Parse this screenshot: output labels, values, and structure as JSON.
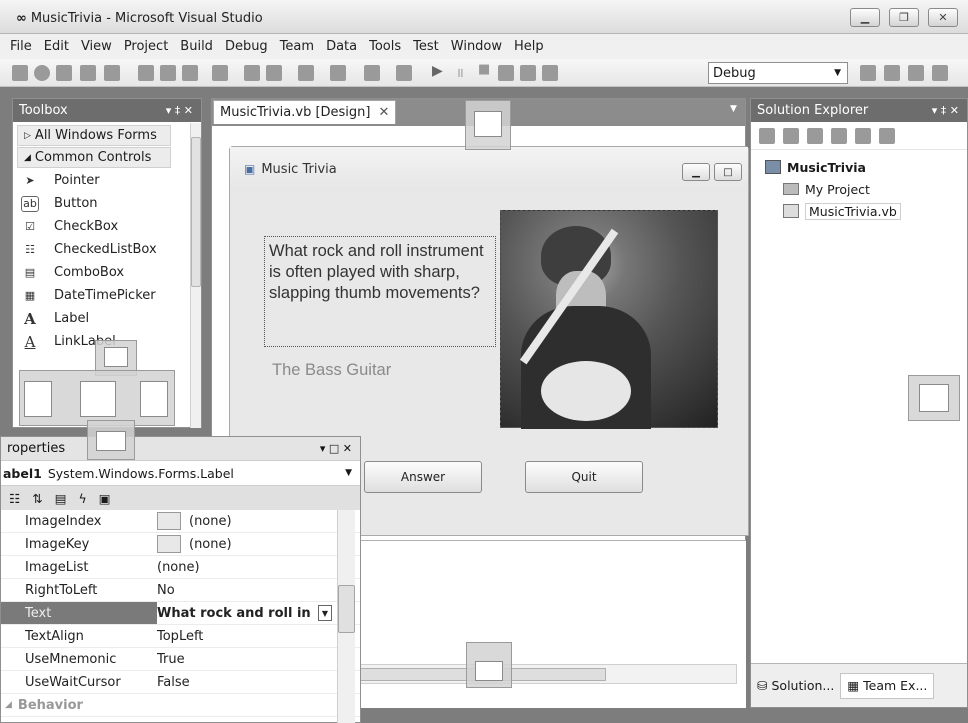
{
  "window": {
    "title": "MusicTrivia - Microsoft Visual Studio"
  },
  "menu": [
    "File",
    "Edit",
    "View",
    "Project",
    "Build",
    "Debug",
    "Team",
    "Data",
    "Tools",
    "Test",
    "Window",
    "Help"
  ],
  "toolbar": {
    "config_value": "Debug"
  },
  "toolbox": {
    "title": "Toolbox",
    "group_all": "All Windows Forms",
    "group_common": "Common Controls",
    "items": [
      {
        "label": "Pointer",
        "icon": "pointer-icon",
        "glyph": "➤"
      },
      {
        "label": "Button",
        "icon": "button-icon",
        "glyph": "ab"
      },
      {
        "label": "CheckBox",
        "icon": "checkbox-icon",
        "glyph": "☑"
      },
      {
        "label": "CheckedListBox",
        "icon": "checkedlistbox-icon",
        "glyph": "☷"
      },
      {
        "label": "ComboBox",
        "icon": "combobox-icon",
        "glyph": "▤"
      },
      {
        "label": "DateTimePicker",
        "icon": "datetimepicker-icon",
        "glyph": "▦"
      },
      {
        "label": "Label",
        "icon": "label-icon",
        "glyph": "A"
      },
      {
        "label": "LinkLabel",
        "icon": "linklabel-icon",
        "glyph": "A"
      }
    ]
  },
  "document": {
    "tab_label": "MusicTrivia.vb [Design]",
    "form_title": "Music Trivia",
    "question": "What rock and roll instrument is often played with sharp, slapping thumb movements?",
    "answer": "The Bass Guitar",
    "answer_button": "Answer",
    "quit_button": "Quit"
  },
  "solution_explorer": {
    "title": "Solution Explorer",
    "project": "MusicTrivia",
    "items": [
      "My Project",
      "MusicTrivia.vb"
    ],
    "bottom_tabs": [
      "Solution...",
      "Team Ex..."
    ]
  },
  "properties": {
    "title": "roperties",
    "object_name": "abel1",
    "object_type": "System.Windows.Forms.Label",
    "rows": [
      {
        "name": "ImageIndex",
        "value": "(none)"
      },
      {
        "name": "ImageKey",
        "value": "(none)"
      },
      {
        "name": "ImageList",
        "value": "(none)"
      },
      {
        "name": "RightToLeft",
        "value": "No"
      },
      {
        "name": "Text",
        "value": "What rock and roll in"
      },
      {
        "name": "TextAlign",
        "value": "TopLeft"
      },
      {
        "name": "UseMnemonic",
        "value": "True"
      },
      {
        "name": "UseWaitCursor",
        "value": "False"
      }
    ],
    "category": "Behavior"
  }
}
